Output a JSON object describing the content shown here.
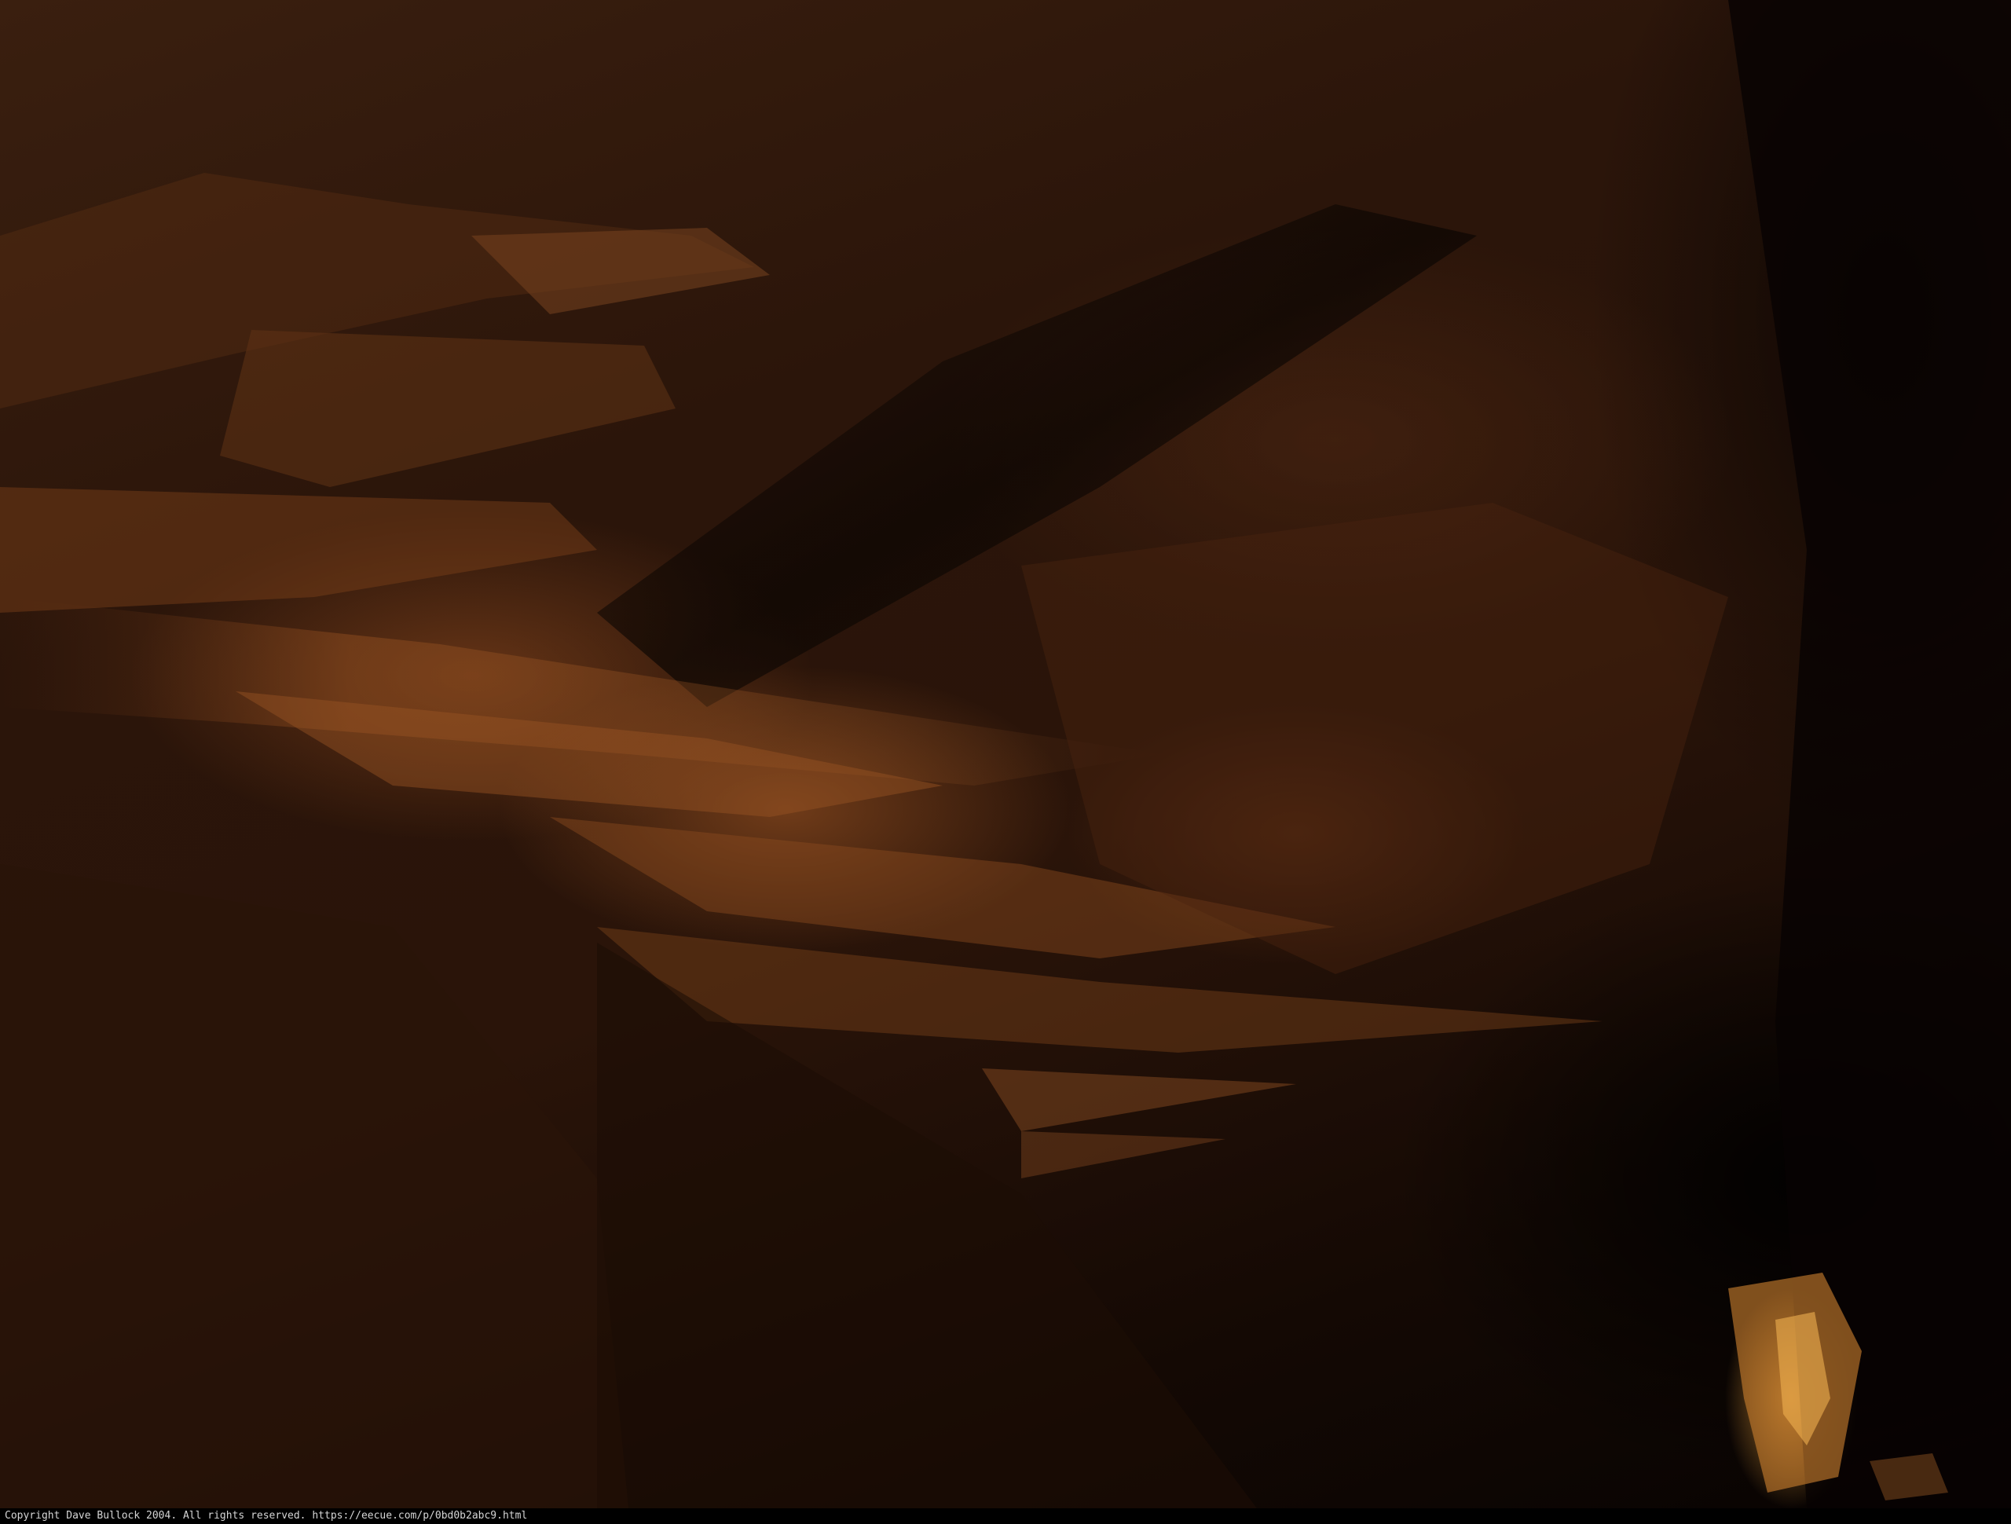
{
  "photo": {
    "subject": "cave-formations"
  },
  "caption": {
    "text": "Copyright Dave Bullock 2004. All rights reserved. https://eecue.com/p/0bd0b2abc9.html"
  }
}
